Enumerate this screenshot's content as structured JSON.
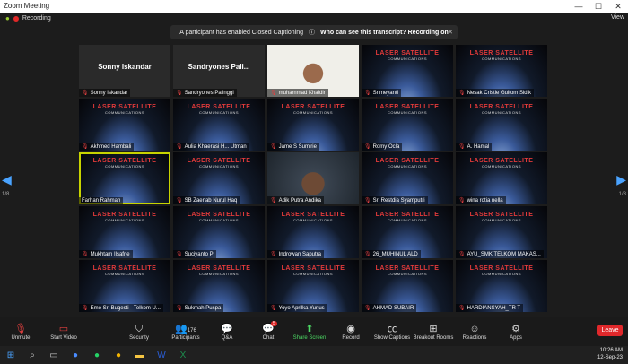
{
  "window": {
    "title": "Zoom Meeting",
    "minimize": "—",
    "maximize": "☐",
    "close": "✕"
  },
  "top": {
    "recording": "Recording",
    "view": "View"
  },
  "banner": {
    "text": "A participant has enabled Closed Captioning",
    "question": "Who can see this transcript? Recording on",
    "close": "✕"
  },
  "pagination": {
    "left": "1/8",
    "right": "1/8"
  },
  "tiles": [
    {
      "name": "Sonny Iskandar",
      "big": "Sonny Iskandar",
      "style": "blank",
      "muted": false
    },
    {
      "name": "Sandryones Pali...",
      "big": "Sandryones  Pali...",
      "style": "blank",
      "muted": false
    },
    {
      "name": "",
      "big": "",
      "style": "face",
      "muted": false
    },
    {
      "name": "",
      "big": "",
      "style": "video",
      "muted": false
    },
    {
      "name": "",
      "big": "",
      "style": "video",
      "muted": false
    },
    {
      "name": "Sonny Iskandar",
      "style": "blank",
      "muted": true
    },
    {
      "name": "Sandryones Palinggi",
      "style": "blank",
      "muted": true
    },
    {
      "name": "muhammad Khaidir",
      "style": "blank",
      "muted": true
    },
    {
      "name": "Srimeyanti",
      "style": "video",
      "muted": true
    },
    {
      "name": "Nesak Cristie Gultom Sidik",
      "style": "video",
      "muted": true
    },
    {
      "name": "Akhmed Hambali",
      "style": "video",
      "muted": true
    },
    {
      "name": "Aulia Khaerasi H... Utman",
      "style": "video",
      "muted": true
    },
    {
      "name": "Jame S Sumirie",
      "style": "video",
      "muted": true
    },
    {
      "name": "Romy Ocla",
      "style": "video",
      "muted": true
    },
    {
      "name": "A. Hamal",
      "style": "video",
      "muted": true
    },
    {
      "name": "Farhan Rahman",
      "style": "video",
      "muted": false,
      "active": true
    },
    {
      "name": "SB Zaenab Nurul Haq",
      "style": "video",
      "muted": true
    },
    {
      "name": "Adik Putra Andika",
      "style": "face-dark",
      "muted": true
    },
    {
      "name": "Sri Restdia Syamputri",
      "style": "video",
      "muted": true
    },
    {
      "name": "wina rotia nella",
      "style": "video",
      "muted": true
    },
    {
      "name": "Mukhtam Ilsafrie",
      "style": "video",
      "muted": true
    },
    {
      "name": "Suciyanto P",
      "style": "video",
      "muted": true
    },
    {
      "name": "Indrowan Saputra",
      "style": "video",
      "muted": true
    },
    {
      "name": "26_MUHINUL ALD",
      "style": "video",
      "muted": true
    },
    {
      "name": "AYU_SMK TELKOM MAKAS...",
      "style": "video",
      "muted": true
    },
    {
      "name": "Emo Sri Bugesti - Telkom U...",
      "style": "video",
      "muted": true
    },
    {
      "name": "Sukmah Puspa",
      "style": "video",
      "muted": true
    },
    {
      "name": "Yoyo Aprilka Yunus",
      "style": "video",
      "muted": true
    },
    {
      "name": "AHMAD SUBAIR",
      "style": "video",
      "muted": true
    },
    {
      "name": "HARDIANSYAH_TR T",
      "style": "video",
      "muted": true
    }
  ],
  "slide": {
    "title": "LASER SATELLITE",
    "sub": "COMMUNICATIONS"
  },
  "toolbar": {
    "unmute": "Unmute",
    "start_video": "Start Video",
    "security": "Security",
    "participants": "Participants",
    "participants_count": "176",
    "qa": "Q&A",
    "chat": "Chat",
    "chat_badge": "5",
    "share": "Share Screen",
    "record": "Record",
    "captions": "Show Captions",
    "breakout": "Breakout Rooms",
    "reactions": "Reactions",
    "apps": "Apps",
    "leave": "Leave"
  },
  "tray": {
    "time": "10:26 AM",
    "date": "12-Sep-23"
  }
}
